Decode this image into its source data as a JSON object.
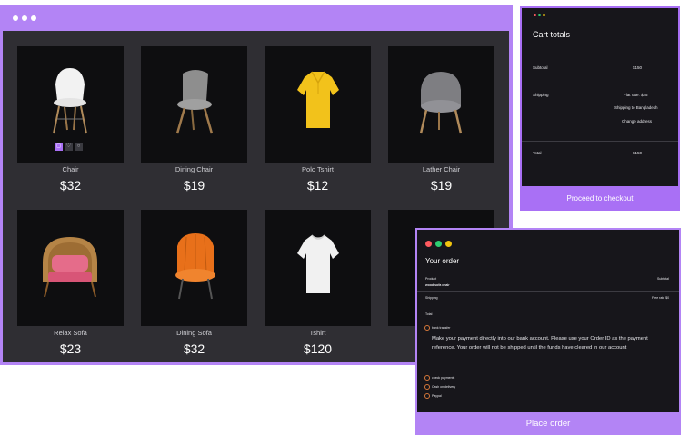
{
  "shop": {
    "products": [
      {
        "name": "Chair",
        "price": "$32",
        "image": "white-chair-image"
      },
      {
        "name": "Dining Chair",
        "price": "$19",
        "image": "gray-dining-chair-image"
      },
      {
        "name": "Polo Tshirt",
        "price": "$12",
        "image": "yellow-polo-tshirt-image"
      },
      {
        "name": "Lather Chair",
        "price": "$19",
        "image": "gray-leather-chair-image"
      },
      {
        "name": "Relax Sofa",
        "price": "$23",
        "image": "rattan-sofa-image"
      },
      {
        "name": "Dining Sofa",
        "price": "$32",
        "image": "orange-sofa-chair-image"
      },
      {
        "name": "Tshirt",
        "price": "$120",
        "image": "white-tshirt-image"
      }
    ],
    "card_actions": [
      "cart-icon",
      "heart-icon",
      "search-icon"
    ],
    "accent_color": "#b384f5"
  },
  "cart": {
    "title": "Cart totals",
    "subtotal_label": "Subtotal",
    "subtotal_value": "$150",
    "shipping_label": "Shipping",
    "shipping_rate": "Flat rate: $25",
    "shipping_to": "Shipping to Bangladesh",
    "change_address": "Change address",
    "total_label": "Total",
    "total_value": "$150",
    "checkout_label": "Proceed to checkout"
  },
  "order": {
    "title": "Your order",
    "product_header": "Product",
    "subtotal_header": "Subtotal",
    "product_name": "wood sofa chair",
    "shipping_label": "Shipping",
    "shipping_value": "Free rate $0",
    "total_label": "Total",
    "payment_method": "bank transfer",
    "payment_description": "Make your payment directly into our bank account. Please use your Order ID as the payment reference. Your order will not be shipped until the funds have cleared in our account",
    "other_methods": [
      "check payments",
      "Cash on delivery",
      "Paypal"
    ],
    "place_order_label": "Place order",
    "window_dots": [
      "#ff5a5f",
      "#2ecc71",
      "#f1c40f"
    ]
  }
}
